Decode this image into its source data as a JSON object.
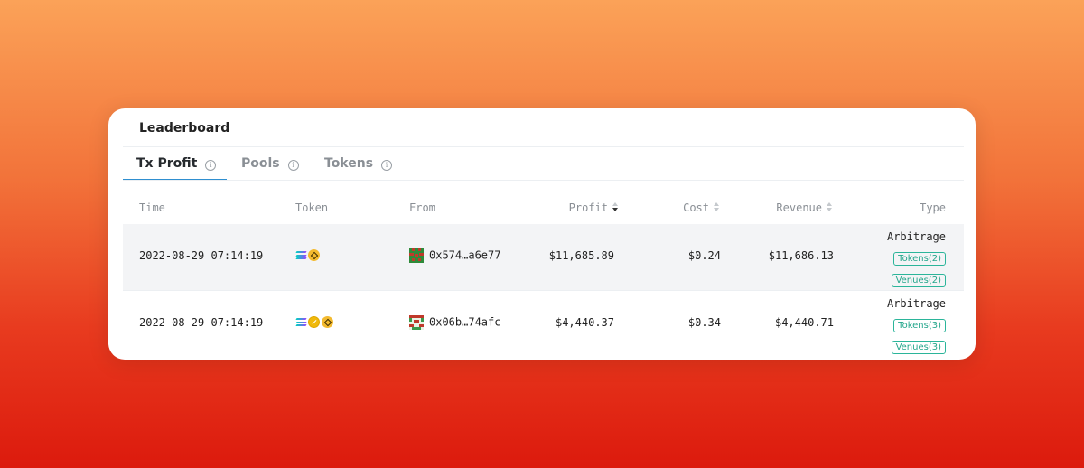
{
  "card": {
    "title": "Leaderboard"
  },
  "tabs": [
    {
      "label": "Tx Profit",
      "active": true
    },
    {
      "label": "Pools",
      "active": false
    },
    {
      "label": "Tokens",
      "active": false
    }
  ],
  "info_icon_glyph": "i",
  "columns": {
    "time": "Time",
    "token": "Token",
    "from": "From",
    "profit": "Profit",
    "cost": "Cost",
    "revenue": "Revenue",
    "type": "Type"
  },
  "sort": {
    "column": "profit",
    "direction": "desc"
  },
  "rows": [
    {
      "time": "2022-08-29 07:14:19",
      "tokens": [
        "solana-icon",
        "bnb-icon"
      ],
      "from": "0x574…a6e77",
      "profit": "$11,685.89",
      "cost": "$0.24",
      "revenue": "$11,686.13",
      "type": "Arbitrage",
      "tokens_tag": "Tokens(2)",
      "venues_tag": "Venues(2)"
    },
    {
      "time": "2022-08-29 07:14:19",
      "tokens": [
        "solana-icon",
        "busd-icon",
        "bnb-icon"
      ],
      "from": "0x06b…74afc",
      "profit": "$4,440.37",
      "cost": "$0.34",
      "revenue": "$4,440.71",
      "type": "Arbitrage",
      "tokens_tag": "Tokens(3)",
      "venues_tag": "Venues(3)"
    }
  ],
  "colors": {
    "accent_tab": "#2f8fd0",
    "tag": "#23a68b",
    "row_alt": "#f3f4f6"
  }
}
